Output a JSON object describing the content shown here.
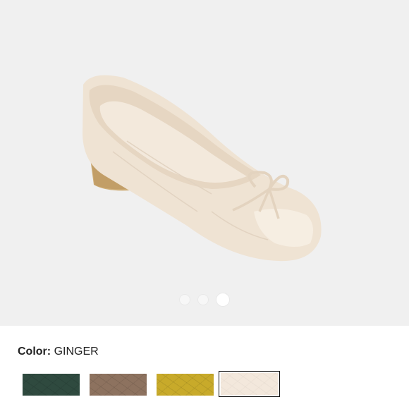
{
  "product": {
    "color_label": "Color:",
    "color_value": "GINGER",
    "gallery": {
      "slide_count": 3,
      "active_slide": 3
    },
    "swatches": [
      {
        "name": "green",
        "color": "#2f4a3f",
        "selected": false
      },
      {
        "name": "taupe",
        "color": "#8d725f",
        "selected": false
      },
      {
        "name": "yellow",
        "color": "#c8aa2a",
        "selected": false
      },
      {
        "name": "ginger",
        "color": "#f3e8dc",
        "selected": true
      }
    ]
  }
}
